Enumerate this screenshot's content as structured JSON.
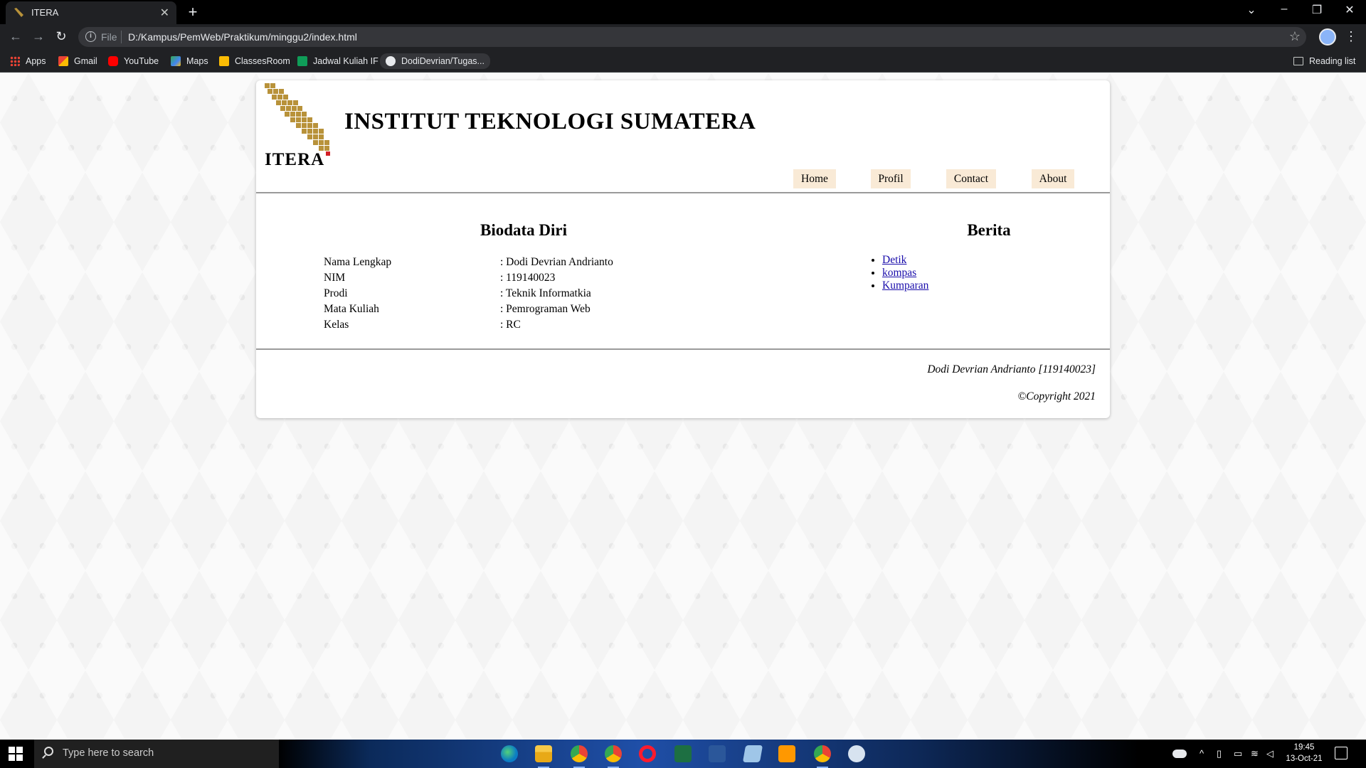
{
  "browser": {
    "tab_title": "ITERA",
    "tab_close": "✕",
    "new_tab": "+",
    "window_controls": {
      "dropdown": "⌄",
      "minimize": "–",
      "restore": "❐",
      "close": "✕"
    },
    "omnibox": {
      "scheme": "File",
      "url": "D:/Kampus/PemWeb/Praktikum/minggu2/index.html"
    },
    "bookmarks": [
      {
        "label": "Apps",
        "icon": "apps-grid-icon"
      },
      {
        "label": "Gmail",
        "icon": "gmail-icon"
      },
      {
        "label": "YouTube",
        "icon": "youtube-icon"
      },
      {
        "label": "Maps",
        "icon": "maps-icon"
      },
      {
        "label": "ClassesRoom",
        "icon": "classroom-icon"
      },
      {
        "label": "Jadwal Kuliah IF",
        "icon": "sheets-icon"
      },
      {
        "label": "DodiDevrian/Tugas...",
        "icon": "github-icon"
      }
    ],
    "reading_list": "Reading list"
  },
  "page": {
    "logo_text": "ITERA",
    "institution": "INSTITUT TEKNOLOGI SUMATERA",
    "nav": [
      "Home",
      "Profil",
      "Contact",
      "About"
    ],
    "biodata": {
      "title": "Biodata Diri",
      "rows": [
        {
          "label": "Nama Lengkap",
          "value": ": Dodi Devrian Andrianto"
        },
        {
          "label": "NIM",
          "value": ": 119140023"
        },
        {
          "label": "Prodi",
          "value": ": Teknik Informatkia"
        },
        {
          "label": "Mata Kuliah",
          "value": ": Pemrograman Web"
        },
        {
          "label": "Kelas",
          "value": ": RC"
        }
      ]
    },
    "berita": {
      "title": "Berita",
      "links": [
        "Detik",
        "kompas",
        "Kumparan"
      ]
    },
    "footer": {
      "author": "Dodi Devrian Andrianto [119140023]",
      "copyright": "©Copyright 2021"
    }
  },
  "taskbar": {
    "search_placeholder": "Type here to search",
    "time": "19:45",
    "date": "13-Oct-21",
    "apps": [
      "edge-icon",
      "file-explorer-icon",
      "chrome-icon",
      "chrome-profile-icon",
      "opera-icon",
      "excel-icon",
      "word-icon",
      "notepad-icon",
      "sublime-text-icon",
      "chrome-active-icon",
      "snipping-tool-icon"
    ]
  },
  "colors": {
    "nav_button_bg": "#f9ead6",
    "logo_gold": "#b8923a",
    "logo_red": "#d21f26",
    "link": "#1a0dab"
  }
}
